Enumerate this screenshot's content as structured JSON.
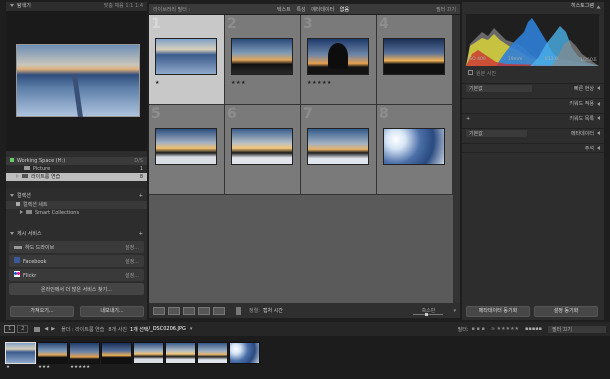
{
  "left": {
    "navigator": {
      "title": "탐색기",
      "opts": [
        "맞춤",
        "채움",
        "1:1",
        "1:4"
      ]
    },
    "catalog_rows": [
      {
        "label": "Working Space (H:)",
        "meta": "D/S"
      },
      {
        "label": "Picture",
        "meta": "1"
      },
      {
        "label": "라이트룸 연습",
        "meta": "8"
      }
    ],
    "collections": {
      "title": "컬렉션",
      "items": [
        "컬렉션 세트",
        "Smart Collections"
      ]
    },
    "publish": {
      "title": "게시 서비스",
      "items": [
        {
          "label": "하드 드라이브",
          "setting": "설정..."
        },
        {
          "label": "Facebook",
          "setting": "설정..."
        },
        {
          "label": "Flickr",
          "setting": "설정..."
        }
      ],
      "more": "온라인에서 더 많은 서비스 찾기..."
    },
    "import_btn": "가져오기...",
    "export_btn": "내보내기..."
  },
  "toolbar_top": {
    "tabs": [
      "텍스트",
      "특성",
      "메타데이터",
      "없음"
    ],
    "filter": "필터 끄기"
  },
  "grid": {
    "cells": [
      {
        "num": "1",
        "stars": "★",
        "selected": true
      },
      {
        "num": "2",
        "stars": "★★★",
        "selected": false
      },
      {
        "num": "3",
        "stars": "★★★★★",
        "selected": false
      },
      {
        "num": "4",
        "stars": "",
        "selected": false
      },
      {
        "num": "5",
        "stars": "",
        "selected": false
      },
      {
        "num": "6",
        "stars": "",
        "selected": false
      },
      {
        "num": "7",
        "stars": "",
        "selected": false
      },
      {
        "num": "8",
        "stars": "",
        "selected": false
      }
    ]
  },
  "toolbar_bottom": {
    "sort_label": "정렬:",
    "sort_value": "캡처 시간",
    "thumb_label": "축소판"
  },
  "right": {
    "histogram": {
      "title": "히스토그램",
      "iso": "ISO 400",
      "focal": "19mm",
      "aperture": "f/13.0",
      "shutter": "1/250초",
      "original": "원본 사진"
    },
    "quick": {
      "preset": "기본값",
      "title": "빠른 현상"
    },
    "sections": [
      "키워드 적용",
      "키워드 목록",
      "메타데이터",
      "주석"
    ],
    "meta_preset": "기본값",
    "sync_btn": "메타데이터 동기화",
    "sync_settings": "설정 동기화"
  },
  "statusbar": {
    "page1": "1",
    "page2": "2",
    "path": "폴더 : 라이트룸 연습",
    "count": "8개 사진",
    "selected": "1개 선택",
    "filename": "/_DSC0206.JPG",
    "filter_label": "필터:",
    "filter_value": "필터 끄기"
  },
  "filmstrip": {
    "stars": [
      "★",
      "",
      "★★★",
      "★★★★★",
      "",
      "",
      "",
      ""
    ]
  }
}
